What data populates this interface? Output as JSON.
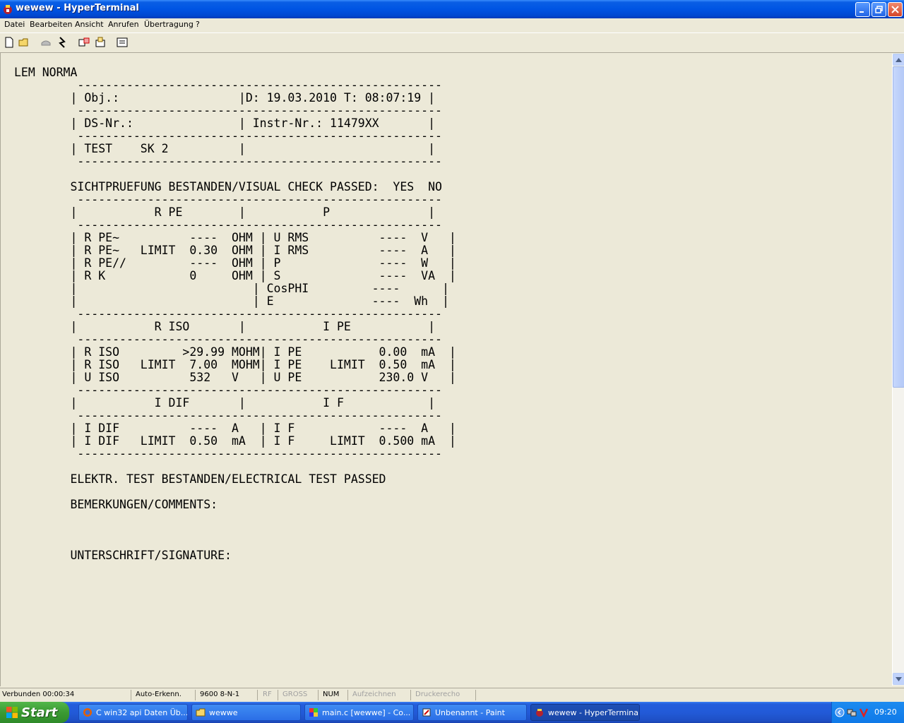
{
  "window": {
    "title": "wewew - HyperTerminal"
  },
  "menu": [
    "Datei",
    "Bearbeiten",
    "Ansicht",
    "Anrufen",
    "Übertragung",
    "?"
  ],
  "toolbar": {
    "icons": [
      "new-document-icon",
      "open-folder-icon",
      "disconnect-icon",
      "connect-icon",
      "send-icon",
      "receive-icon",
      "properties-icon"
    ]
  },
  "terminal": {
    "text": "LEM NORMA\n         ----------------------------------------------------\n        | Obj.:                 |D: 19.03.2010 T: 08:07:19 |\n         ----------------------------------------------------\n        | DS-Nr.:               | Instr-Nr.: 11479XX       |\n         ----------------------------------------------------\n        | TEST    SK 2          |                          |\n         ----------------------------------------------------\n\n        SICHTPRUEFUNG BESTANDEN/VISUAL CHECK PASSED:  YES  NO\n         ----------------------------------------------------\n        |           R PE        |           P              |\n         ----------------------------------------------------\n        | R PE~          ----  OHM | U RMS          ----  V   |\n        | R PE~   LIMIT  0.30  OHM | I RMS          ----  A   |\n        | R PE//         ----  OHM | P              ----  W   |\n        | R K            0     OHM | S              ----  VA  |\n        |                         | CosPHI         ----      |\n        |                         | E              ----  Wh  |\n         ----------------------------------------------------\n        |           R ISO       |           I PE           |\n         ----------------------------------------------------\n        | R ISO         >29.99 MOHM| I PE           0.00  mA  |\n        | R ISO   LIMIT  7.00  MOHM| I PE    LIMIT  0.50  mA  |\n        | U ISO          532   V   | U PE           230.0 V   |\n         ----------------------------------------------------\n        |           I DIF       |           I F            |\n         ----------------------------------------------------\n        | I DIF          ----  A   | I F            ----  A   |\n        | I DIF   LIMIT  0.50  mA  | I F     LIMIT  0.500 mA  |\n         ----------------------------------------------------\n\n        ELEKTR. TEST BESTANDEN/ELECTRICAL TEST PASSED\n\n        BEMERKUNGEN/COMMENTS:\n\n\n\n        UNTERSCHRIFT/SIGNATURE:"
  },
  "status": {
    "connected": "Verbunden 00:00:34",
    "detect": "Auto-Erkenn.",
    "port": "9600 8-N-1",
    "rf": "RF",
    "caps": "GROSS",
    "num": "NUM",
    "capture": "Aufzeichnen",
    "print_echo": "Druckerecho"
  },
  "taskbar": {
    "start": "Start",
    "tasks": [
      {
        "label": "C win32 api Daten Üb...",
        "icon": "firefox-icon"
      },
      {
        "label": "wewwe",
        "icon": "folder-icon"
      },
      {
        "label": "main.c [wewwe] - Co...",
        "icon": "codeblocks-icon"
      },
      {
        "label": "Unbenannt - Paint",
        "icon": "paint-icon"
      },
      {
        "label": "wewew - HyperTerminal",
        "icon": "hyperterminal-icon"
      }
    ],
    "clock": "09:20"
  }
}
